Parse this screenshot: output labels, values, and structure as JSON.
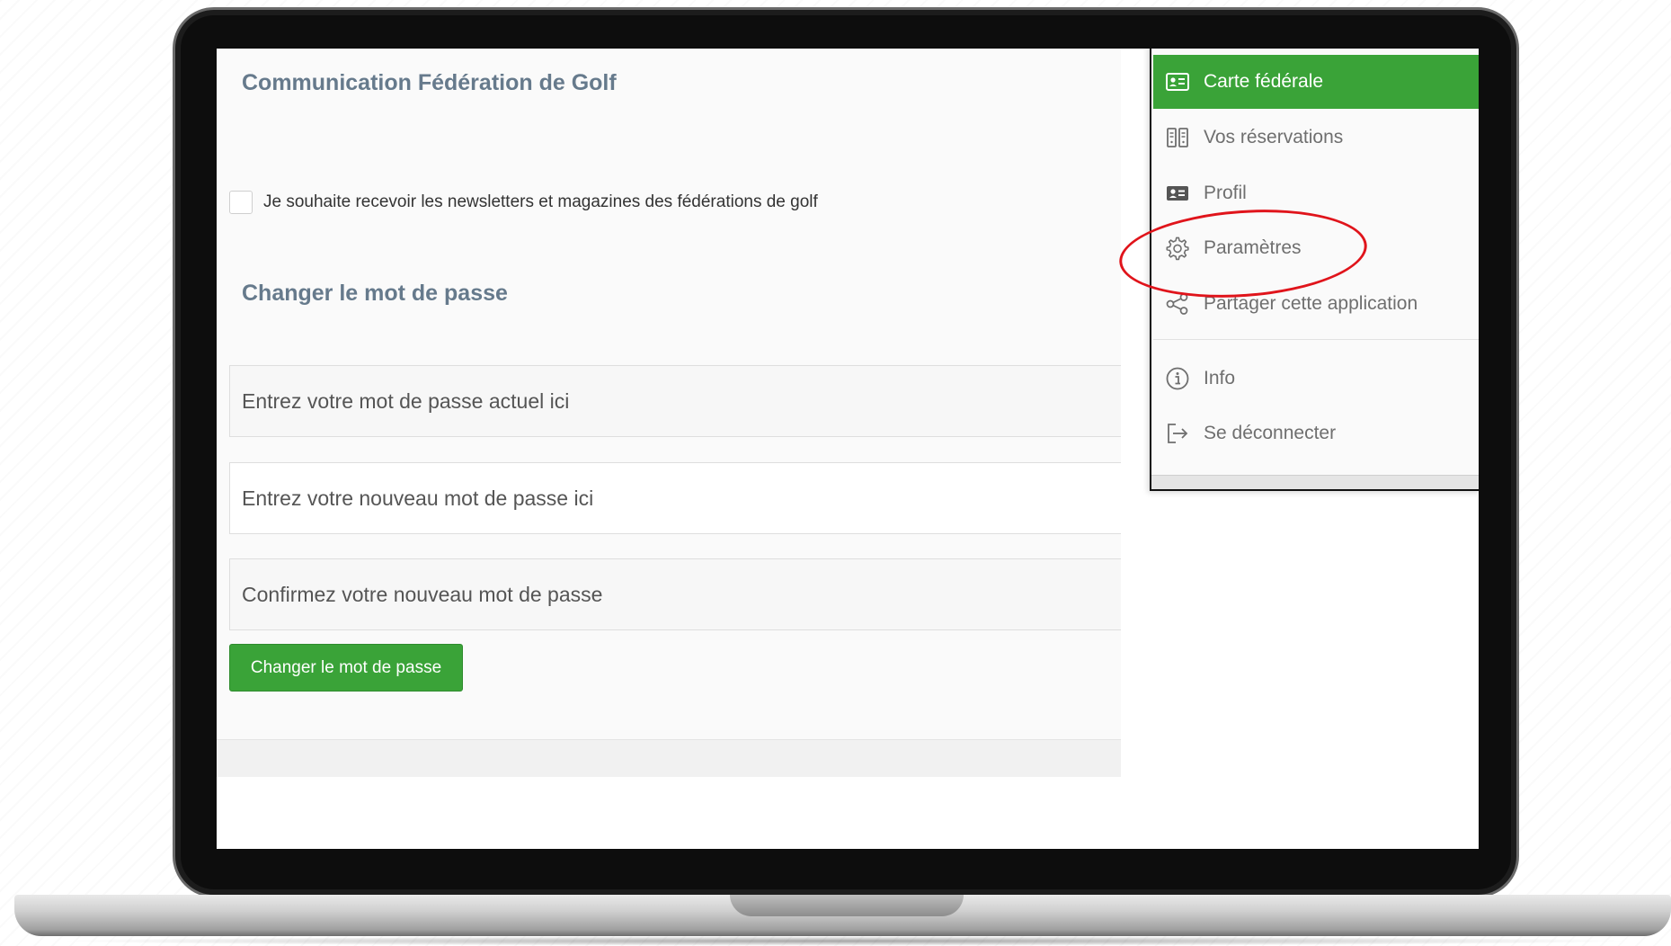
{
  "settings": {
    "communication_title": "Communication Fédération de Golf",
    "newsletter_label": "Je souhaite recevoir les newsletters et magazines des fédérations de golf",
    "newsletter_checked": false,
    "password_title": "Changer le mot de passe",
    "current_password_placeholder": "Entrez votre mot de passe actuel ici",
    "new_password_placeholder": "Entrez votre nouveau mot de passe ici",
    "confirm_password_placeholder": "Confirmez votre nouveau mot de passe",
    "submit_label": "Changer le mot de passe"
  },
  "menu": {
    "items": [
      {
        "label": "Carte fédérale",
        "icon": "id-card-icon",
        "active": true
      },
      {
        "label": "Vos réservations",
        "icon": "reservations-icon",
        "active": false
      },
      {
        "label": "Profil",
        "icon": "profile-card-icon",
        "active": false
      },
      {
        "label": "Paramètres",
        "icon": "gear-icon",
        "active": false
      },
      {
        "label": "Partager cette application",
        "icon": "share-icon",
        "active": false
      },
      {
        "label": "Info",
        "icon": "info-icon",
        "active": false
      },
      {
        "label": "Se déconnecter",
        "icon": "logout-icon",
        "active": false
      }
    ]
  },
  "colors": {
    "accent_green": "#3aa338",
    "title_gray": "#667a8c",
    "highlight_red": "#e0141b"
  }
}
